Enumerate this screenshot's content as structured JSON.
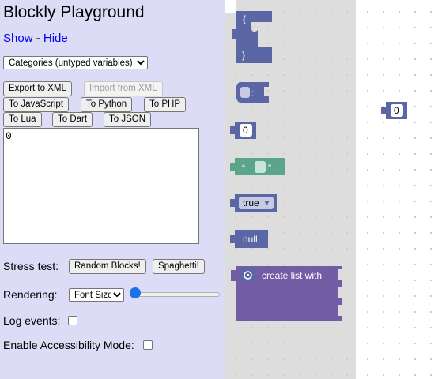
{
  "page": {
    "title": "Blockly Playground"
  },
  "visibility": {
    "show_label": "Show",
    "separator": "-",
    "hide_label": "Hide"
  },
  "toolbox_select": {
    "selected": "Categories (untyped variables)"
  },
  "export_buttons": {
    "export_xml": "Export to XML",
    "import_xml": "Import from XML",
    "to_javascript": "To JavaScript",
    "to_python": "To Python",
    "to_php": "To PHP",
    "to_lua": "To Lua",
    "to_dart": "To Dart",
    "to_json": "To JSON"
  },
  "output": {
    "value": "0"
  },
  "stress_test": {
    "label": "Stress test:",
    "random_blocks": "Random Blocks!",
    "spaghetti": "Spaghetti!"
  },
  "rendering": {
    "label": "Rendering:",
    "selected": "Font Size",
    "slider_value_fraction": 0.0
  },
  "log_events": {
    "label": "Log events:",
    "checked": false
  },
  "accessibility": {
    "label": "Enable Accessibility Mode:",
    "checked": false
  },
  "flyout_blocks": {
    "object_open": "{",
    "object_close": "}",
    "member_colon": ":",
    "number_value": "0",
    "string_open_quote": "“",
    "string_close_quote": "”",
    "boolean_value": "true",
    "null_value": "null",
    "create_list": "create list with"
  },
  "workspace_blocks": {
    "number_value": "0"
  },
  "colors": {
    "object_block": "#5b67a5",
    "string_block": "#5ba58c",
    "list_block": "#745ba5",
    "flyout_bg": "#dddddd",
    "page_bg": "#dcdcf7"
  },
  "icons": {
    "mutator": "gear-icon",
    "dropdown": "caret-down-icon"
  }
}
